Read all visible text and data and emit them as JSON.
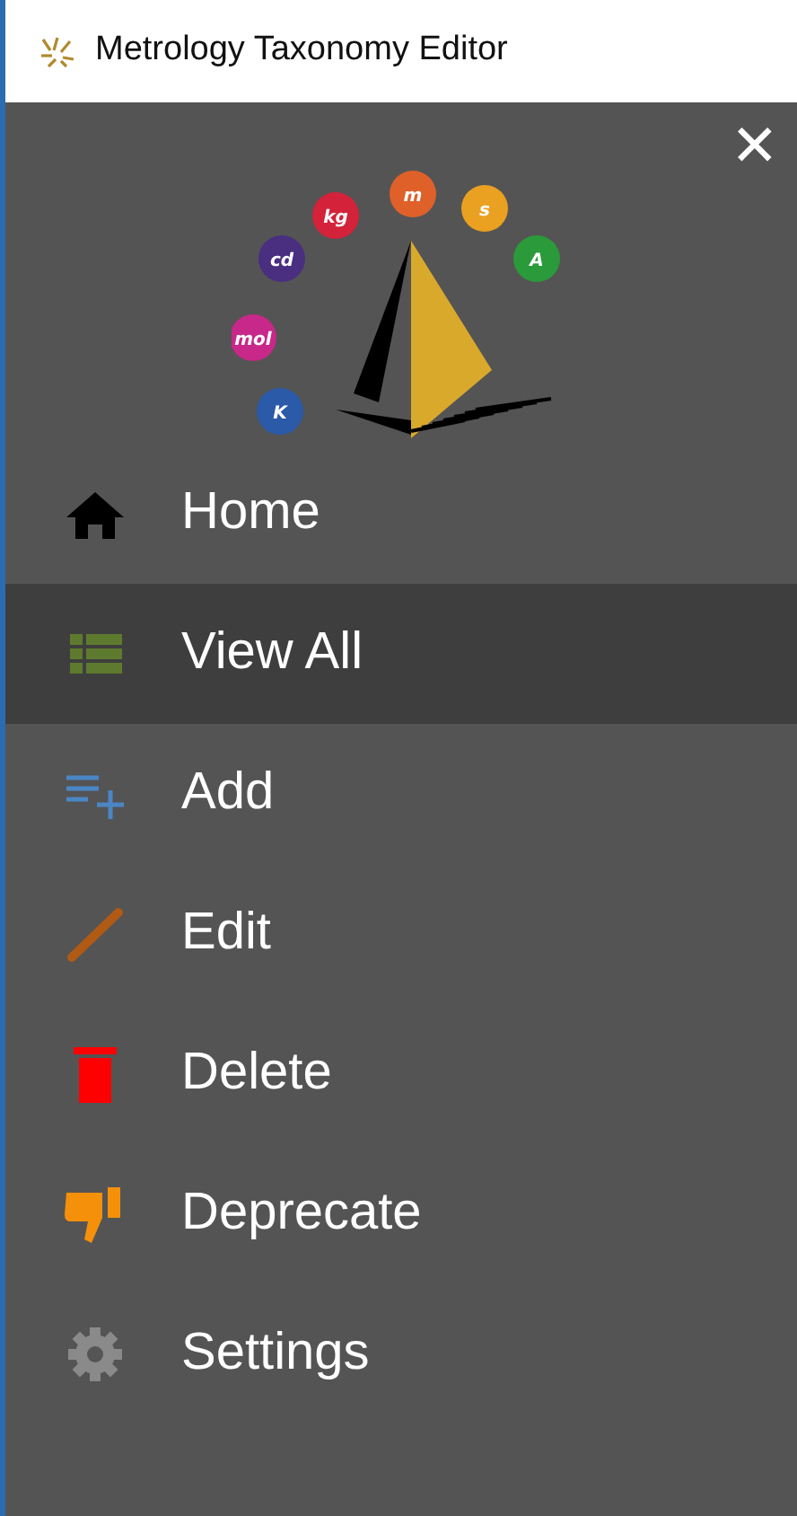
{
  "window": {
    "title": "Metrology Taxonomy Editor"
  },
  "close_button": {
    "label": "✕"
  },
  "logo": {
    "units": [
      {
        "label": "kg",
        "color": "#d3223a"
      },
      {
        "label": "m",
        "color": "#e0602a"
      },
      {
        "label": "s",
        "color": "#eaa020"
      },
      {
        "label": "A",
        "color": "#2a9a3a"
      },
      {
        "label": "cd",
        "color": "#4a2e80"
      },
      {
        "label": "mol",
        "color": "#c8288a"
      },
      {
        "label": "K",
        "color": "#2a5aa8"
      }
    ]
  },
  "menu": [
    {
      "kind": "home",
      "label": "Home",
      "selected": false
    },
    {
      "kind": "list",
      "label": "View All",
      "selected": true
    },
    {
      "kind": "add",
      "label": "Add",
      "selected": false
    },
    {
      "kind": "edit",
      "label": "Edit",
      "selected": false
    },
    {
      "kind": "delete",
      "label": "Delete",
      "selected": false
    },
    {
      "kind": "deprecate",
      "label": "Deprecate",
      "selected": false
    },
    {
      "kind": "settings",
      "label": "Settings",
      "selected": false
    }
  ]
}
